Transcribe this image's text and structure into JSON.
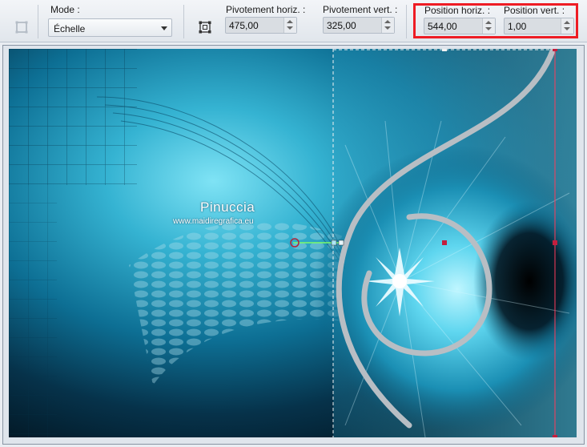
{
  "toolbar": {
    "mode": {
      "label": "Mode :",
      "value": "Échelle"
    },
    "pivot_h": {
      "label": "Pivotement horiz. :",
      "value": "475,00"
    },
    "pivot_v": {
      "label": "Pivotement vert. :",
      "value": "325,00"
    },
    "pos_h": {
      "label": "Position horiz. :",
      "value": "544,00"
    },
    "pos_v": {
      "label": "Position vert. :",
      "value": "1,00"
    }
  },
  "canvas": {
    "watermark_title": "Pinuccia",
    "watermark_url": "www.maidiregrafica.eu"
  },
  "colors": {
    "highlight": "#ee1c24",
    "canvas_teal": "#0a5e80",
    "glow_cyan": "#7fe3f5"
  }
}
